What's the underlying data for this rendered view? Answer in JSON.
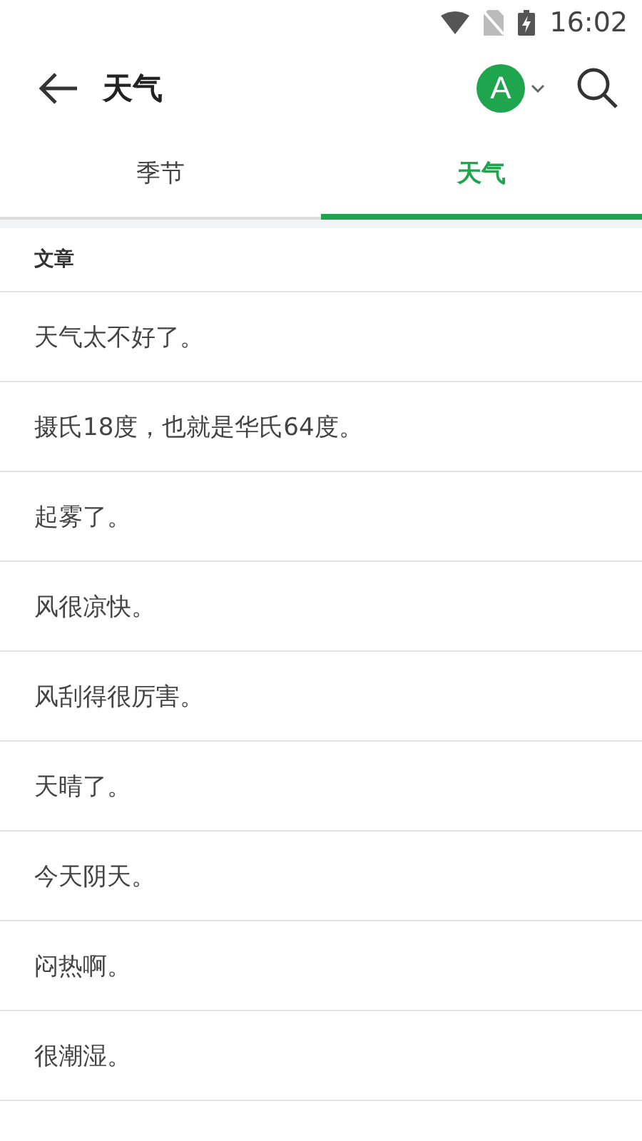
{
  "status_bar": {
    "time": "16:02"
  },
  "toolbar": {
    "title": "天气",
    "avatar": "A"
  },
  "tabs": [
    {
      "label": "季节",
      "selected": false
    },
    {
      "label": "天气",
      "selected": true
    }
  ],
  "section": {
    "title": "文章"
  },
  "sentences": [
    "天气太不好了。",
    "摄氏18度，也就是华氏64度。",
    "起雾了。",
    "风很凉快。",
    "风刮得很厉害。",
    "天晴了。",
    "今天阴天。",
    "闷热啊。",
    "很潮湿。"
  ]
}
